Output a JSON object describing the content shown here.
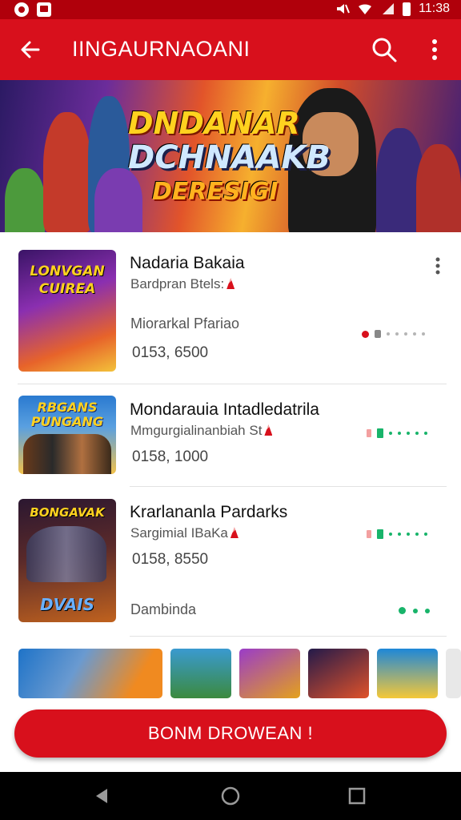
{
  "status_bar": {
    "time": "11:38"
  },
  "app_bar": {
    "title": "IINGAURNAOANI"
  },
  "banner": {
    "line1": "DNDANAR",
    "line2": "DCHNAAKB",
    "line3": "DERESIGI"
  },
  "games": [
    {
      "name": "Nadaria Bakaia",
      "subtitle": "Bardpran Btels:",
      "extra": "Miorarkal Pfariao",
      "count": "0153, 6500",
      "thumb_text": "LONVGAN CUIREA",
      "thumb_colors": [
        "#3a1466",
        "#e7632a"
      ]
    },
    {
      "name": "Mondarauia Intadledatrila",
      "subtitle": "Mmgurgialinanbiah St",
      "count": "0158, 1000",
      "thumb_text": "RBGANS PUNGANG",
      "thumb_colors": [
        "#2a7ad0",
        "#f2c14a"
      ]
    },
    {
      "name": "Krarlananla Pardarks",
      "subtitle": "Sargimial IBaKa",
      "count": "0158, 8550",
      "extra": "Dambinda",
      "thumb_text": "BONGAVAK",
      "thumb_text2": "DVAIS",
      "thumb_colors": [
        "#2b1730",
        "#c0621e"
      ]
    }
  ],
  "strip_thumbs": [
    {
      "label": "game-thumb-1",
      "colors": [
        "#1e73c8",
        "#f08a20"
      ]
    },
    {
      "label": "game-thumb-2",
      "colors": [
        "#3a9ad0",
        "#3b8a3e"
      ]
    },
    {
      "label": "game-thumb-3",
      "colors": [
        "#9a3cc8",
        "#e4a11c"
      ]
    },
    {
      "label": "game-thumb-4",
      "colors": [
        "#231a4a",
        "#e0522a"
      ]
    },
    {
      "label": "game-thumb-5",
      "colors": [
        "#1e87d8",
        "#f5c838"
      ]
    }
  ],
  "cta": {
    "label": "BONM DROWEAN !"
  },
  "colors": {
    "brand_red": "#d8101c",
    "status_red": "#b0000b",
    "accent_green": "#18b46a"
  }
}
